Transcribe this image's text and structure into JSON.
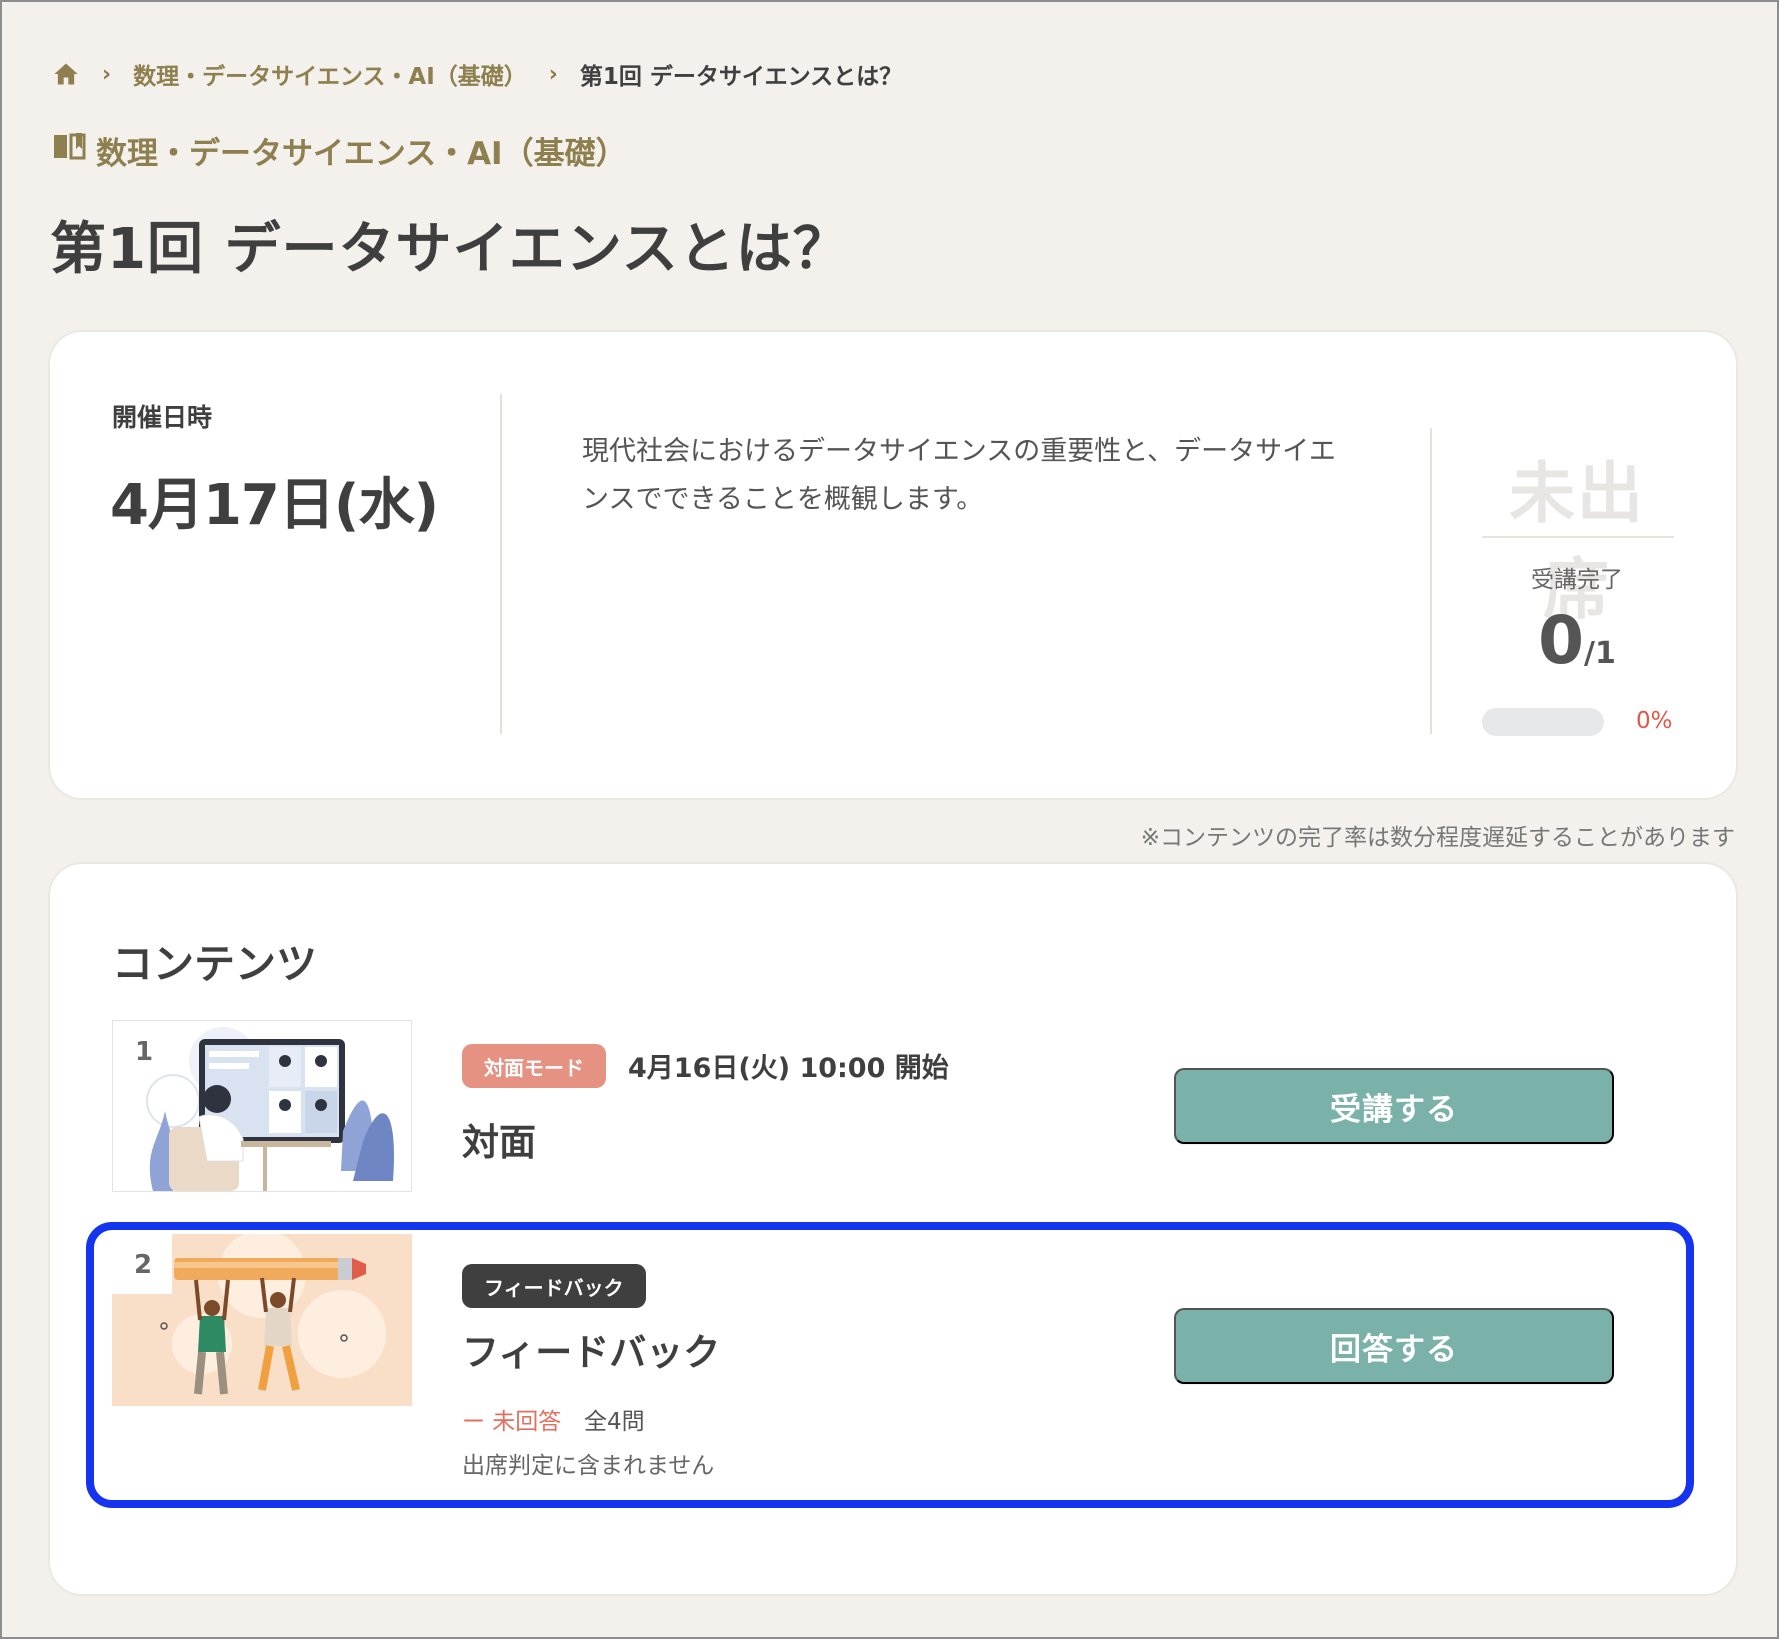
{
  "breadcrumb": {
    "home_icon": "home-icon",
    "course": "数理・データサイエンス・AI（基礎）",
    "current": "第1回 データサイエンスとは？"
  },
  "course_label": {
    "icon": "book-icon",
    "text": "数理・データサイエンス・AI（基礎）"
  },
  "page_title": "第1回 データサイエンスとは？",
  "session": {
    "date_label": "開催日時",
    "date_value": "4月17日(水)",
    "description": "現代社会におけるデータサイエンスの重要性と、データサイエンスでできることを概観します。",
    "attendance_status": "未出席",
    "completion_label": "受講完了",
    "completed": "0",
    "total": "/1",
    "progress_fraction": 0,
    "progress_percent_text": "0%"
  },
  "note": "※コンテンツの完了率は数分程度遅延することがあります",
  "contents": {
    "title": "コンテンツ",
    "items": [
      {
        "number": "1",
        "tag": "対面モード",
        "start": "4月16日(火) 10:00 開始",
        "title": "対面",
        "button": "受講する"
      },
      {
        "number": "2",
        "tag": "フィードバック",
        "title": "フィードバック",
        "status": "ー 未回答",
        "total_questions": "全4問",
        "note": "出席判定に含まれません",
        "button": "回答する"
      }
    ]
  },
  "colors": {
    "accent_olive": "#8d7f4e",
    "button_teal": "#7ab1a8",
    "alert_red": "#e3564a",
    "tag_salmon": "#e59282",
    "highlight_blue": "#1434f0"
  }
}
